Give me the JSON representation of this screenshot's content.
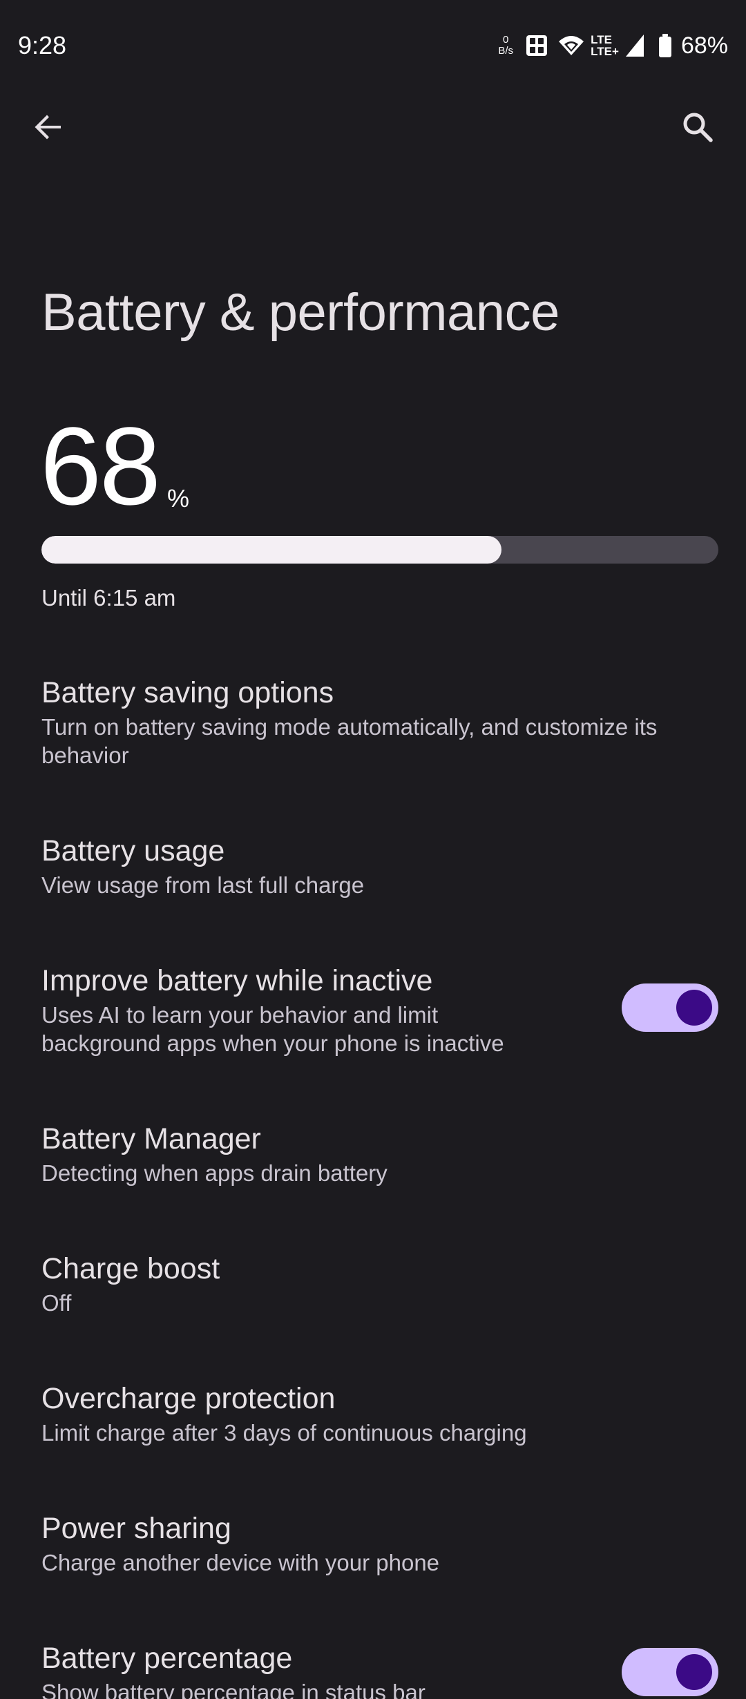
{
  "status_bar": {
    "time": "9:28",
    "net_speed_value": "0",
    "net_speed_unit": "B/s",
    "lte_top": "LTE",
    "lte_bottom": "LTE+",
    "battery_percent": "68%"
  },
  "icons": {
    "back": "arrow-back-icon",
    "search": "search-icon",
    "sim": "dual-sim-icon",
    "wifi": "wifi-icon",
    "signal": "signal-icon",
    "battery": "battery-icon"
  },
  "page": {
    "title": "Battery & performance"
  },
  "battery": {
    "level": "68",
    "unit": "%",
    "fill_percent": 68,
    "until": "Until 6:15 am"
  },
  "settings": [
    {
      "title": "Battery saving options",
      "summary_line1": "Turn on battery saving mode automatically, and customize its",
      "summary_line2": "behavior"
    },
    {
      "title": "Battery usage",
      "summary": "View usage from last full charge"
    },
    {
      "title": "Improve battery while inactive",
      "summary_line1": "Uses AI to learn your behavior and limit",
      "summary_line2": "background apps when your phone is inactive",
      "toggle_on": true
    },
    {
      "title": "Battery Manager",
      "summary": "Detecting when apps drain battery"
    },
    {
      "title": "Charge boost",
      "summary": "Off"
    },
    {
      "title": "Overcharge protection",
      "summary": "Limit charge after 3 days of continuous charging"
    },
    {
      "title": "Power sharing",
      "summary": "Charge another device with your phone"
    },
    {
      "title": "Battery percentage",
      "summary": "Show battery percentage in status bar",
      "toggle_on": true
    }
  ],
  "colors": {
    "background": "#1c1b1f",
    "toggle_track": "#d0bcff",
    "toggle_knob": "#3b0a86",
    "progress_fill": "#f4eff4",
    "progress_track": "#49464f"
  }
}
